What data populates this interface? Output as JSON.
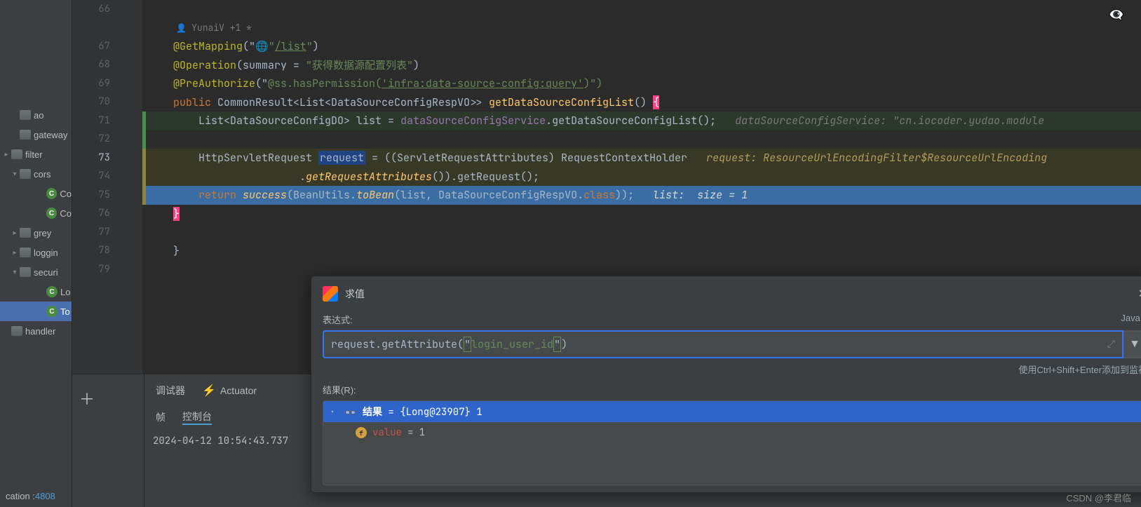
{
  "sidebar": {
    "items": [
      {
        "label": "ao",
        "kind": "folder",
        "ind": 1
      },
      {
        "label": "gateway",
        "kind": "folder",
        "ind": 1
      },
      {
        "label": "filter",
        "kind": "folder",
        "ind": 0,
        "arrow": "col"
      },
      {
        "label": "cors",
        "kind": "folder",
        "ind": 1,
        "arrow": "exp"
      },
      {
        "label": "Co",
        "kind": "class",
        "ind": 3
      },
      {
        "label": "Co",
        "kind": "class",
        "ind": 3
      },
      {
        "label": "grey",
        "kind": "folder",
        "ind": 1,
        "arrow": "col"
      },
      {
        "label": "loggin",
        "kind": "folder",
        "ind": 1,
        "arrow": "col"
      },
      {
        "label": "securi",
        "kind": "folder",
        "ind": 1,
        "arrow": "exp"
      },
      {
        "label": "Lo",
        "kind": "class",
        "ind": 3
      },
      {
        "label": "To",
        "kind": "class",
        "ind": 3,
        "sel": true
      },
      {
        "label": "handler",
        "kind": "folder",
        "ind": 0
      }
    ],
    "bottom_label": "cation :",
    "bottom_value": "4808"
  },
  "editor": {
    "author": "YunaiV +1 *",
    "lines": [
      66,
      67,
      68,
      69,
      70,
      71,
      72,
      73,
      74,
      75,
      76,
      77,
      78,
      79
    ],
    "current": 73,
    "inline_hints": {
      "l71": "dataSourceConfigService: \"cn.iocoder.yudao.module",
      "l73": "request: ResourceUrlEncodingFilter$ResourceUrlEncoding",
      "l75": "list:  size = 1"
    },
    "code": {
      "l67": {
        "ann": "@GetMapping",
        "str_pre": "(\"",
        "link": "/list",
        "str_post": "\")"
      },
      "l68": {
        "ann": "@Operation",
        "args": "(summary = ",
        "str": "\"获得数据源配置列表\"",
        "close": ")"
      },
      "l69": {
        "ann": "@PreAuthorize",
        "args": "(\"",
        "perm": "@ss.hasPermission(",
        "link": "'infra:data-source-config:query'",
        "close": ")\")"
      },
      "l70": {
        "kw": "public",
        "ty": " CommonResult<List<DataSourceConfigRespVO>> ",
        "fn": "getDataSourceConfigList",
        "post": "() ",
        "brace": "{"
      },
      "l71": {
        "pad": "    ",
        "ty": "List<DataSourceConfigDO>",
        "var": " list ",
        "eq": "= ",
        "svc": "dataSourceConfigService",
        "call": ".getDataSourceConfigList();"
      },
      "l73": {
        "pad": "    ",
        "ty": "HttpServletRequest ",
        "var": "request",
        "rest": " = ((ServletRequestAttributes) RequestContextHolder"
      },
      "l74": {
        "pad": "                    ",
        "rest": ".",
        "ital": "getRequestAttributes",
        "rest2": "()).getRequest();"
      },
      "l75": {
        "pad": "    ",
        "kw": "return ",
        "fn": "success",
        "open": "(BeanUtils.",
        "ital": "toBean",
        "args": "(list, DataSourceConfigRespVO.",
        "cls": "class",
        "close": "));"
      },
      "l76": {
        "brace": "}"
      },
      "l78": {
        "brace": "}"
      }
    }
  },
  "debug": {
    "tabs": {
      "t1": "调试器",
      "t2": "Actuator"
    },
    "frame": {
      "t1": "帧",
      "t2": "控制台"
    },
    "log": "2024-04-12 10:54:43.737"
  },
  "dialog": {
    "title": "求值",
    "expr_label": "表达式:",
    "lang": "Java ▾",
    "expr": {
      "pre": "request.getAttribute(",
      "q": "\"",
      "str": "login_user_id",
      "q2": "\"",
      "post": ")"
    },
    "hint": "使用Ctrl+Shift+Enter添加到监视",
    "result_label": "结果(R):",
    "result": {
      "head_name": "结果",
      "head_val": " = {Long@23907} 1",
      "child_name": "value",
      "child_val": " = 1"
    }
  },
  "watermark": "CSDN @李君临"
}
